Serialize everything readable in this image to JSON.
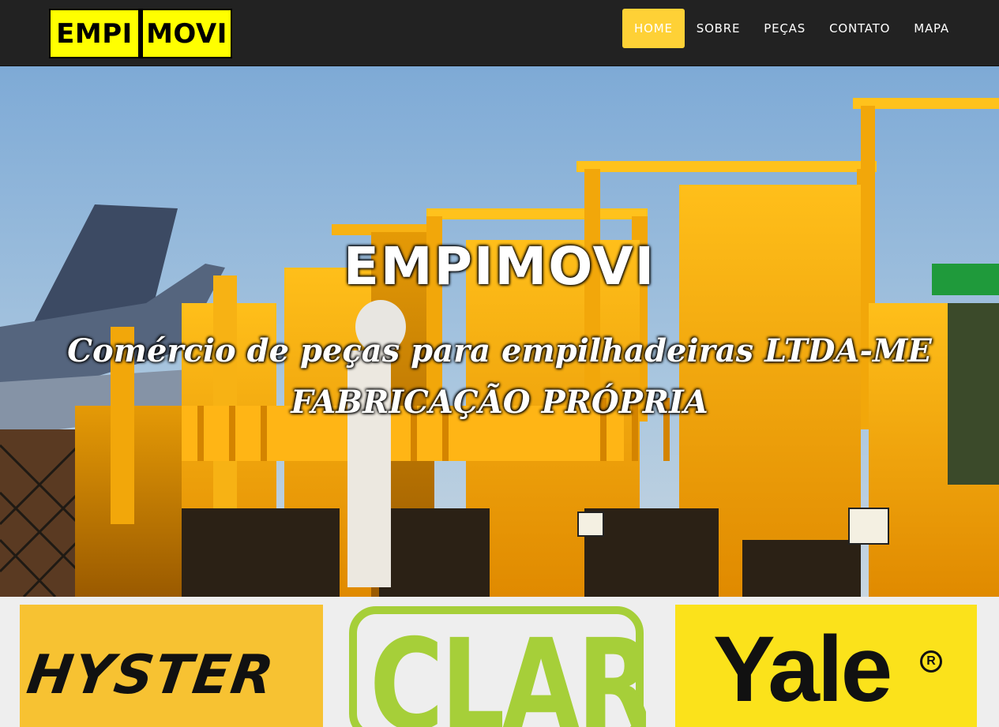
{
  "logo": {
    "part1": "EMPI",
    "part2": "MOVI"
  },
  "nav": {
    "items": [
      {
        "label": "HOME",
        "active": true
      },
      {
        "label": "SOBRE",
        "active": false
      },
      {
        "label": "PEÇAS",
        "active": false
      },
      {
        "label": "CONTATO",
        "active": false
      },
      {
        "label": "MAPA",
        "active": false
      }
    ]
  },
  "hero": {
    "title": "EMPIMOVI",
    "subtitle_line1": "Comércio de peças para empilhadeiras LTDA-ME",
    "subtitle_line2": "FABRICAÇÃO PRÓPRIA"
  },
  "brands": {
    "hyster": "HYSTER",
    "clark": "CLARK",
    "yale": "Yale",
    "yale_mark": "R"
  },
  "colors": {
    "navbar_bg": "#222222",
    "accent": "#fed136",
    "logo_yellow": "#ffff00",
    "hyster_bg": "#f7c232",
    "clark_green": "#a6cf39",
    "yale_bg": "#fbe21b"
  }
}
